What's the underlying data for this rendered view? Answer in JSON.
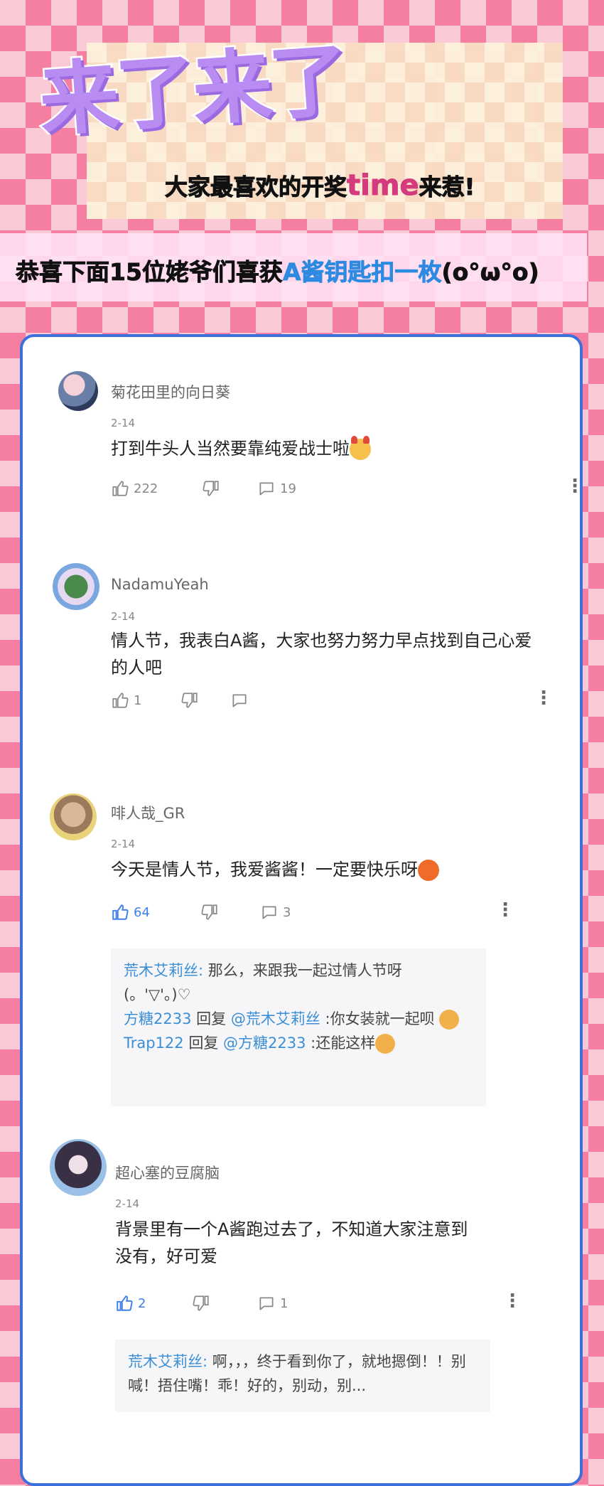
{
  "header": {
    "headline": "来了来了",
    "subtitle_before": "大家最喜欢的开奖",
    "subtitle_accent": "time",
    "subtitle_after": "来惹!"
  },
  "banner": {
    "before": "恭喜下面15位姥爷们喜获",
    "highlight": "A酱钥匙扣一枚",
    "after": "(o°ω°o)"
  },
  "comments": [
    {
      "user": "菊花田里的向日葵",
      "date": "2-14",
      "text": "打到牛头人当然要靠纯爱战士啦",
      "likes": "222",
      "replies_count": "19"
    },
    {
      "user": "NadamuYeah",
      "date": "2-14",
      "text": "情人节，我表白A酱，大家也努力努力早点找到自己心爱的人吧",
      "likes": "1",
      "replies_count": ""
    },
    {
      "user": "啡人哉_GR",
      "date": "2-14",
      "text": "今天是情人节，我爱酱酱！一定要快乐呀",
      "likes": "64",
      "replies_count": "3",
      "replies": [
        {
          "name": "荒木艾莉丝:",
          "text": " 那么，来跟我一起过情人节呀 (。'▽'。)♡"
        },
        {
          "name": "方糖2233",
          "mid": " 回复 ",
          "target": "@荒木艾莉丝",
          "text": " :你女装就一起呗"
        },
        {
          "name": "Trap122",
          "mid": " 回复 ",
          "target": "@方糖2233",
          "text": " :还能这样"
        }
      ]
    },
    {
      "user": "超心塞的豆腐脑",
      "date": "2-14",
      "text": "背景里有一个A酱跑过去了，不知道大家注意到没有，好可爱",
      "likes": "2",
      "replies_count": "1",
      "replies": [
        {
          "name": "荒木艾莉丝:",
          "text": " 啊，，，终于看到你了，就地摁倒！！别喊！捂住嘴！乖！好的，别动，别..."
        }
      ]
    }
  ],
  "colors": {
    "accent_blue": "#3a6fdc",
    "link_blue": "#3b8fd6",
    "pink": "#f47fa1",
    "headline_purple": "#b98cf2"
  },
  "icons": [
    "thumbs-up-icon",
    "thumbs-down-icon",
    "comment-bubble-icon",
    "more-vertical-icon"
  ]
}
